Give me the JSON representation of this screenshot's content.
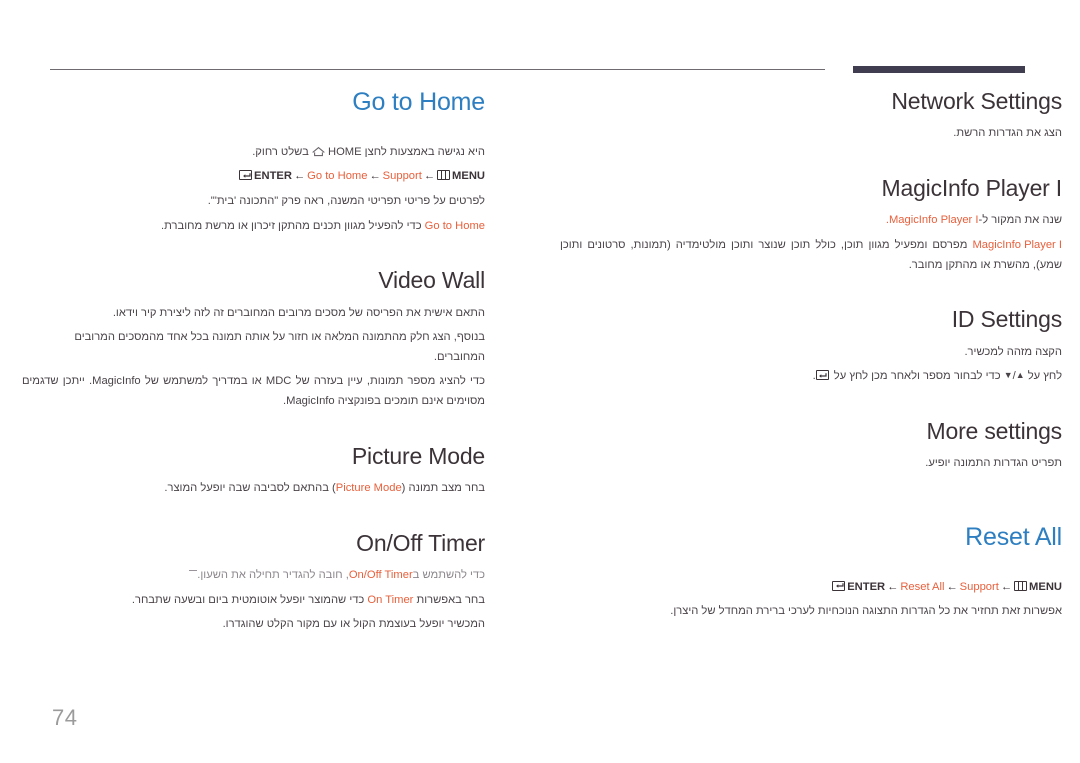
{
  "page": {
    "number": "74",
    "accent_color": "#e8603c",
    "heading_color": "#3b3338",
    "link_heading_color": "#2d7fc1",
    "rule_color": "#6f6a70",
    "tab_color": "#403d51"
  },
  "left_column": {
    "sections": [
      {
        "id": "network-settings",
        "title": "Network Settings",
        "style": "dark",
        "paragraphs": [
          {
            "id": "p1",
            "text": "הצג את הגדרות הרשת."
          }
        ]
      },
      {
        "id": "magicinfo-player-i",
        "title": "MagicInfo Player I",
        "style": "dark",
        "paragraphs": [
          {
            "id": "p1",
            "parts": [
              {
                "t": "text",
                "v": "שנה את המקור ל-"
              },
              {
                "t": "accent",
                "v": "MagicInfo Player I"
              },
              {
                "t": "text",
                "v": "."
              }
            ]
          },
          {
            "id": "p2",
            "parts": [
              {
                "t": "accent",
                "v": "MagicInfo Player I"
              },
              {
                "t": "text",
                "v": " מפרסם ומפעיל מגוון תוכן, כולל תוכן שנוצר ותוכן מולטימדיה (תמונות, סרטונים ותוכן שמע), מהשרת או מהתקן מחובר."
              }
            ]
          }
        ]
      },
      {
        "id": "id-settings",
        "title": "ID Settings",
        "style": "dark",
        "paragraphs": [
          {
            "id": "p1",
            "text": "הקצה מזהה למכשיר."
          },
          {
            "id": "p2",
            "parts": [
              {
                "t": "text",
                "v": "לחץ על "
              },
              {
                "t": "icon",
                "v": "triangle-up-icon",
                "glyph": "▲"
              },
              {
                "t": "text",
                "v": "/"
              },
              {
                "t": "icon",
                "v": "triangle-down-icon",
                "glyph": "▼"
              },
              {
                "t": "text",
                "v": " כדי לבחור מספר ולאחר מכן לחץ על "
              },
              {
                "t": "icon",
                "v": "enter-key-icon"
              },
              {
                "t": "text",
                "v": "."
              }
            ]
          }
        ]
      },
      {
        "id": "more-settings",
        "title": "More settings",
        "style": "dark",
        "paragraphs": [
          {
            "id": "p1",
            "text": "תפריט הגדרות התמונה יופיע."
          }
        ]
      },
      {
        "id": "reset-all",
        "title": "Reset All",
        "style": "blue",
        "breadcrumb": {
          "id": "reset-all-breadcrumb",
          "items": [
            {
              "label": "MENU",
              "kind": "plain",
              "icon": "menu-icon"
            },
            {
              "label": "Support",
              "kind": "accent"
            },
            {
              "label": "Reset All",
              "kind": "accent"
            },
            {
              "label": "ENTER",
              "kind": "plain",
              "icon": "enter-key-icon"
            }
          ],
          "separator": "←"
        },
        "paragraphs": [
          {
            "id": "p1",
            "text": "אפשרות זאת תחזיר את כל הגדרות התצוגה הנוכחיות לערכי ברירת המחדל של היצרן."
          }
        ]
      }
    ]
  },
  "right_column": {
    "sections": [
      {
        "id": "go-to-home",
        "title": "Go to Home",
        "style": "blue",
        "paragraphs": [
          {
            "id": "p1",
            "parts": [
              {
                "t": "text",
                "v": "היא נגישה באמצעות לחצן HOME "
              },
              {
                "t": "icon",
                "v": "home-icon"
              },
              {
                "t": "text",
                "v": " בשלט רחוק."
              }
            ]
          }
        ],
        "breadcrumb": {
          "id": "go-to-home-breadcrumb",
          "items": [
            {
              "label": "MENU",
              "kind": "plain",
              "icon": "menu-icon"
            },
            {
              "label": "Support",
              "kind": "accent"
            },
            {
              "label": "Go to Home",
              "kind": "accent"
            },
            {
              "label": "ENTER",
              "kind": "plain",
              "icon": "enter-key-icon"
            }
          ],
          "separator": "←"
        },
        "paragraphs_after": [
          {
            "id": "p2",
            "text": "לפרטים על פריטי תפריטי המשנה, ראה פרק \"התכונה 'בית'\"."
          },
          {
            "id": "p3",
            "parts": [
              {
                "t": "accent",
                "v": "Go to Home"
              },
              {
                "t": "text",
                "v": " כדי להפעיל מגוון תכנים מהתקן זיכרון או מרשת מחוברת."
              }
            ]
          }
        ]
      },
      {
        "id": "video-wall",
        "title": "Video Wall",
        "style": "dark",
        "paragraphs": [
          {
            "id": "p1",
            "text": "התאם אישית את הפריסה של מסכים מרובים המחוברים זה לזה ליצירת קיר וידאו."
          },
          {
            "id": "p2",
            "text": "בנוסף, הצג חלק מהתמונה המלאה או חזור על אותה תמונה בכל אחד מהמסכים המרובים המחוברים."
          },
          {
            "id": "p3",
            "text": "כדי להציג מספר תמונות, עיין בעזרה של MDC או במדריך למשתמש של MagicInfo. ייתכן שדגמים מסוימים אינם תומכים בפונקציה MagicInfo."
          }
        ]
      },
      {
        "id": "picture-mode",
        "title": "Picture Mode",
        "style": "dark",
        "paragraphs": [
          {
            "id": "p1",
            "parts": [
              {
                "t": "text",
                "v": "בחר מצב תמונה ("
              },
              {
                "t": "accent",
                "v": "Picture Mode"
              },
              {
                "t": "text",
                "v": ") בהתאם לסביבה שבה יופעל המוצר."
              }
            ]
          }
        ]
      },
      {
        "id": "on-off-timer",
        "title": "On/Off Timer",
        "style": "dark",
        "paragraphs": [
          {
            "id": "p1",
            "kind": "note",
            "parts": [
              {
                "t": "text",
                "v": "כדי להשתמש ב"
              },
              {
                "t": "accent",
                "v": "On/Off Timer"
              },
              {
                "t": "text",
                "v": ", חובה להגדיר תחילה את השעון."
              }
            ]
          },
          {
            "id": "p2",
            "parts": [
              {
                "t": "text",
                "v": "בחר באפשרות "
              },
              {
                "t": "accent",
                "v": "On Timer"
              },
              {
                "t": "text",
                "v": " כדי שהמוצר יופעל אוטומטית ביום ובשעה שתבחר."
              }
            ]
          },
          {
            "id": "p3",
            "text": "המכשיר יופעל בעוצמת הקול או עם מקור הקלט שהוגדרו."
          }
        ]
      }
    ]
  }
}
